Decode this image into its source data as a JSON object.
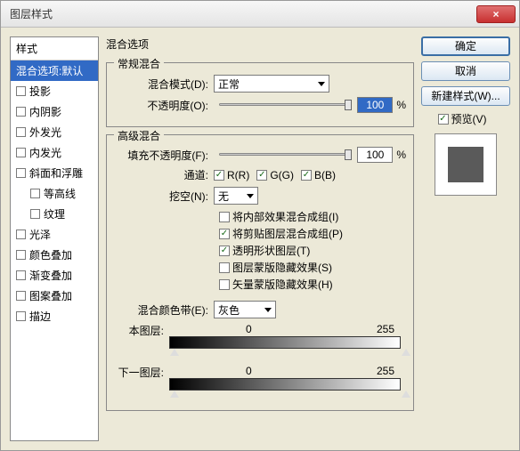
{
  "window": {
    "title": "图层样式",
    "close": "×"
  },
  "styles": {
    "header": "样式",
    "selected": "混合选项:默认",
    "items": [
      "投影",
      "内阴影",
      "外发光",
      "内发光",
      "斜面和浮雕",
      "等高线",
      "纹理",
      "光泽",
      "颜色叠加",
      "渐变叠加",
      "图案叠加",
      "描边"
    ]
  },
  "main": {
    "title": "混合选项",
    "normal": {
      "legend": "常规混合",
      "blend_label": "混合模式(D):",
      "blend_value": "正常",
      "opacity_label": "不透明度(O):",
      "opacity_value": "100",
      "pct": "%"
    },
    "adv": {
      "legend": "高级混合",
      "fill_label": "填充不透明度(F):",
      "fill_value": "100",
      "pct": "%",
      "channel_label": "通道:",
      "ch_r": "R(R)",
      "ch_g": "G(G)",
      "ch_b": "B(B)",
      "knockout_label": "挖空(N):",
      "knockout_value": "无",
      "opt1": "将内部效果混合成组(I)",
      "opt2": "将剪贴图层混合成组(P)",
      "opt3": "透明形状图层(T)",
      "opt4": "图层蒙版隐藏效果(S)",
      "opt5": "矢量蒙版隐藏效果(H)",
      "blendif_label": "混合颜色带(E):",
      "blendif_value": "灰色",
      "this_label": "本图层:",
      "under_label": "下一图层:",
      "v0": "0",
      "v255": "255"
    }
  },
  "right": {
    "ok": "确定",
    "cancel": "取消",
    "newstyle": "新建样式(W)...",
    "preview": "预览(V)"
  }
}
